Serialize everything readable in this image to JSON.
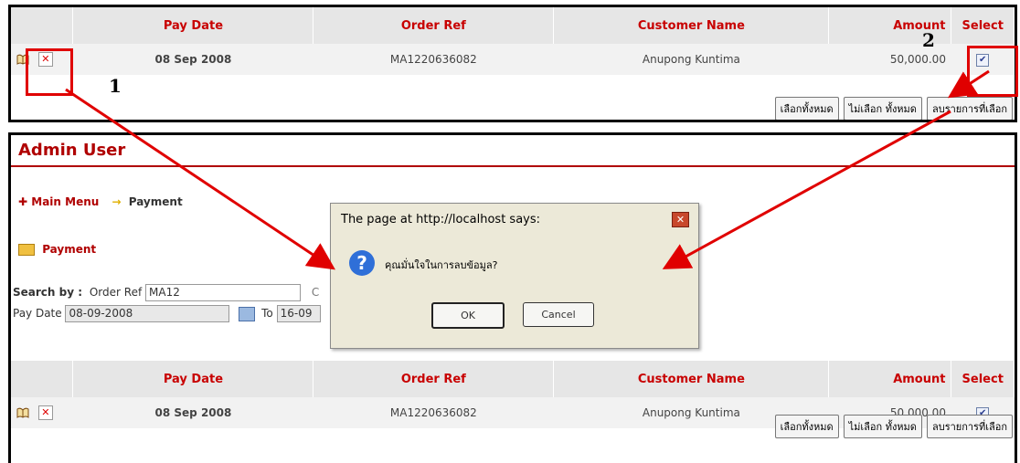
{
  "table": {
    "headers": [
      "",
      "Pay Date",
      "Order Ref",
      "Customer Name",
      "Amount",
      "Select"
    ],
    "row": {
      "pay_date": "08 Sep 2008",
      "order_ref": "MA1220636082",
      "customer": "Anupong  Kuntima",
      "amount": "50,000.00",
      "selected": true
    }
  },
  "buttons": {
    "select_all": "เลือกทั้งหมด",
    "deselect_all": "ไม่เลือก ทั้งหมด",
    "delete_selected": "ลบรายการที่เลือก"
  },
  "callouts": {
    "one": "1",
    "two": "2"
  },
  "page": {
    "title": "Admin User",
    "breadcrumb": {
      "main": "Main Menu",
      "current": "Payment"
    },
    "section": "Payment",
    "search": {
      "label": "Search by :",
      "order_ref_label": "Order Ref",
      "order_ref_value": "MA12",
      "extra_label": "C",
      "pay_date_label": "Pay Date",
      "from_value": "08-09-2008",
      "to_label": "To",
      "to_value": "16-09"
    }
  },
  "dialog": {
    "title": "The page at http://localhost says:",
    "message": "คุณมั่นใจในการลบข้อมูล?",
    "ok": "OK",
    "cancel": "Cancel",
    "close": "✕"
  },
  "colors": {
    "accent": "#b00000",
    "header_text": "#c80000",
    "callout_red": "#e00000"
  }
}
